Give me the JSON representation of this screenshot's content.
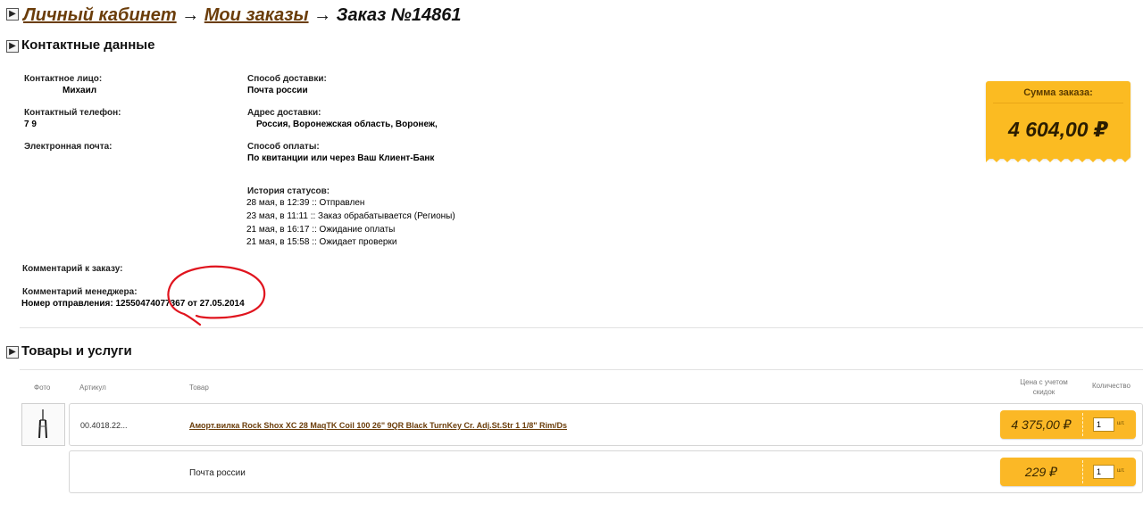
{
  "breadcrumb": {
    "cabinet": "Личный кабинет",
    "orders": "Мои заказы",
    "sep": "→",
    "current": "Заказ №14861"
  },
  "icons": {
    "toggle": "chevron-right-icon",
    "toggle_glyph": "▶"
  },
  "contact": {
    "title": "Контактные данные",
    "person_label": "Контактное лицо:",
    "person_value": "Михаил",
    "phone_label": "Контактный телефон:",
    "phone_value": "7 9",
    "email_label": "Электронная почта:",
    "email_value": "",
    "delivery_method_label": "Способ доставки:",
    "delivery_method_value": "Почта россии",
    "address_label": "Адрес доставки:",
    "address_value": "Россия, Воронежская область, Воронеж,",
    "payment_label": "Способ оплаты:",
    "payment_value": "По квитанции или через Ваш Клиент-Банк",
    "history_label": "История статусов:",
    "history": [
      "28 мая, в 12:39 :: Отправлен",
      "23 мая, в 11:11 :: Заказ обрабатывается (Регионы)",
      "21 мая, в 16:17 :: Ожидание оплаты",
      "21 мая, в 15:58 :: Ожидает проверки"
    ],
    "comment_label": "Комментарий к заказу:",
    "manager_comment_label": "Комментарий менеджера:",
    "manager_comment_value": "Номер отправления: 12550474077367 от 27.05.2014"
  },
  "total": {
    "label": "Сумма заказа:",
    "value": "4 604,00 ₽"
  },
  "goods": {
    "title": "Товары и услуги",
    "columns": {
      "photo": "Фото",
      "article": "Артикул",
      "product": "Товар",
      "price": "Цена с учетом скидок",
      "quantity": "Количество"
    },
    "rows": [
      {
        "article": "00.4018.22...",
        "product": "Аморт.вилка Rock Shox XC 28 MaqTK Coil 100 26\" 9QR Black TurnKey Cr. Adj.St.Str 1 1/8\" Rim/Ds",
        "price": "4 375,00 ₽",
        "quantity": "1",
        "unit": "шт."
      },
      {
        "article": "",
        "product": "Почта россии",
        "price": "229 ₽",
        "quantity": "1",
        "unit": "шт."
      }
    ]
  },
  "colors": {
    "link": "#6b3d0a",
    "accent": "#fbbb22",
    "annotation": "#e0141e"
  }
}
